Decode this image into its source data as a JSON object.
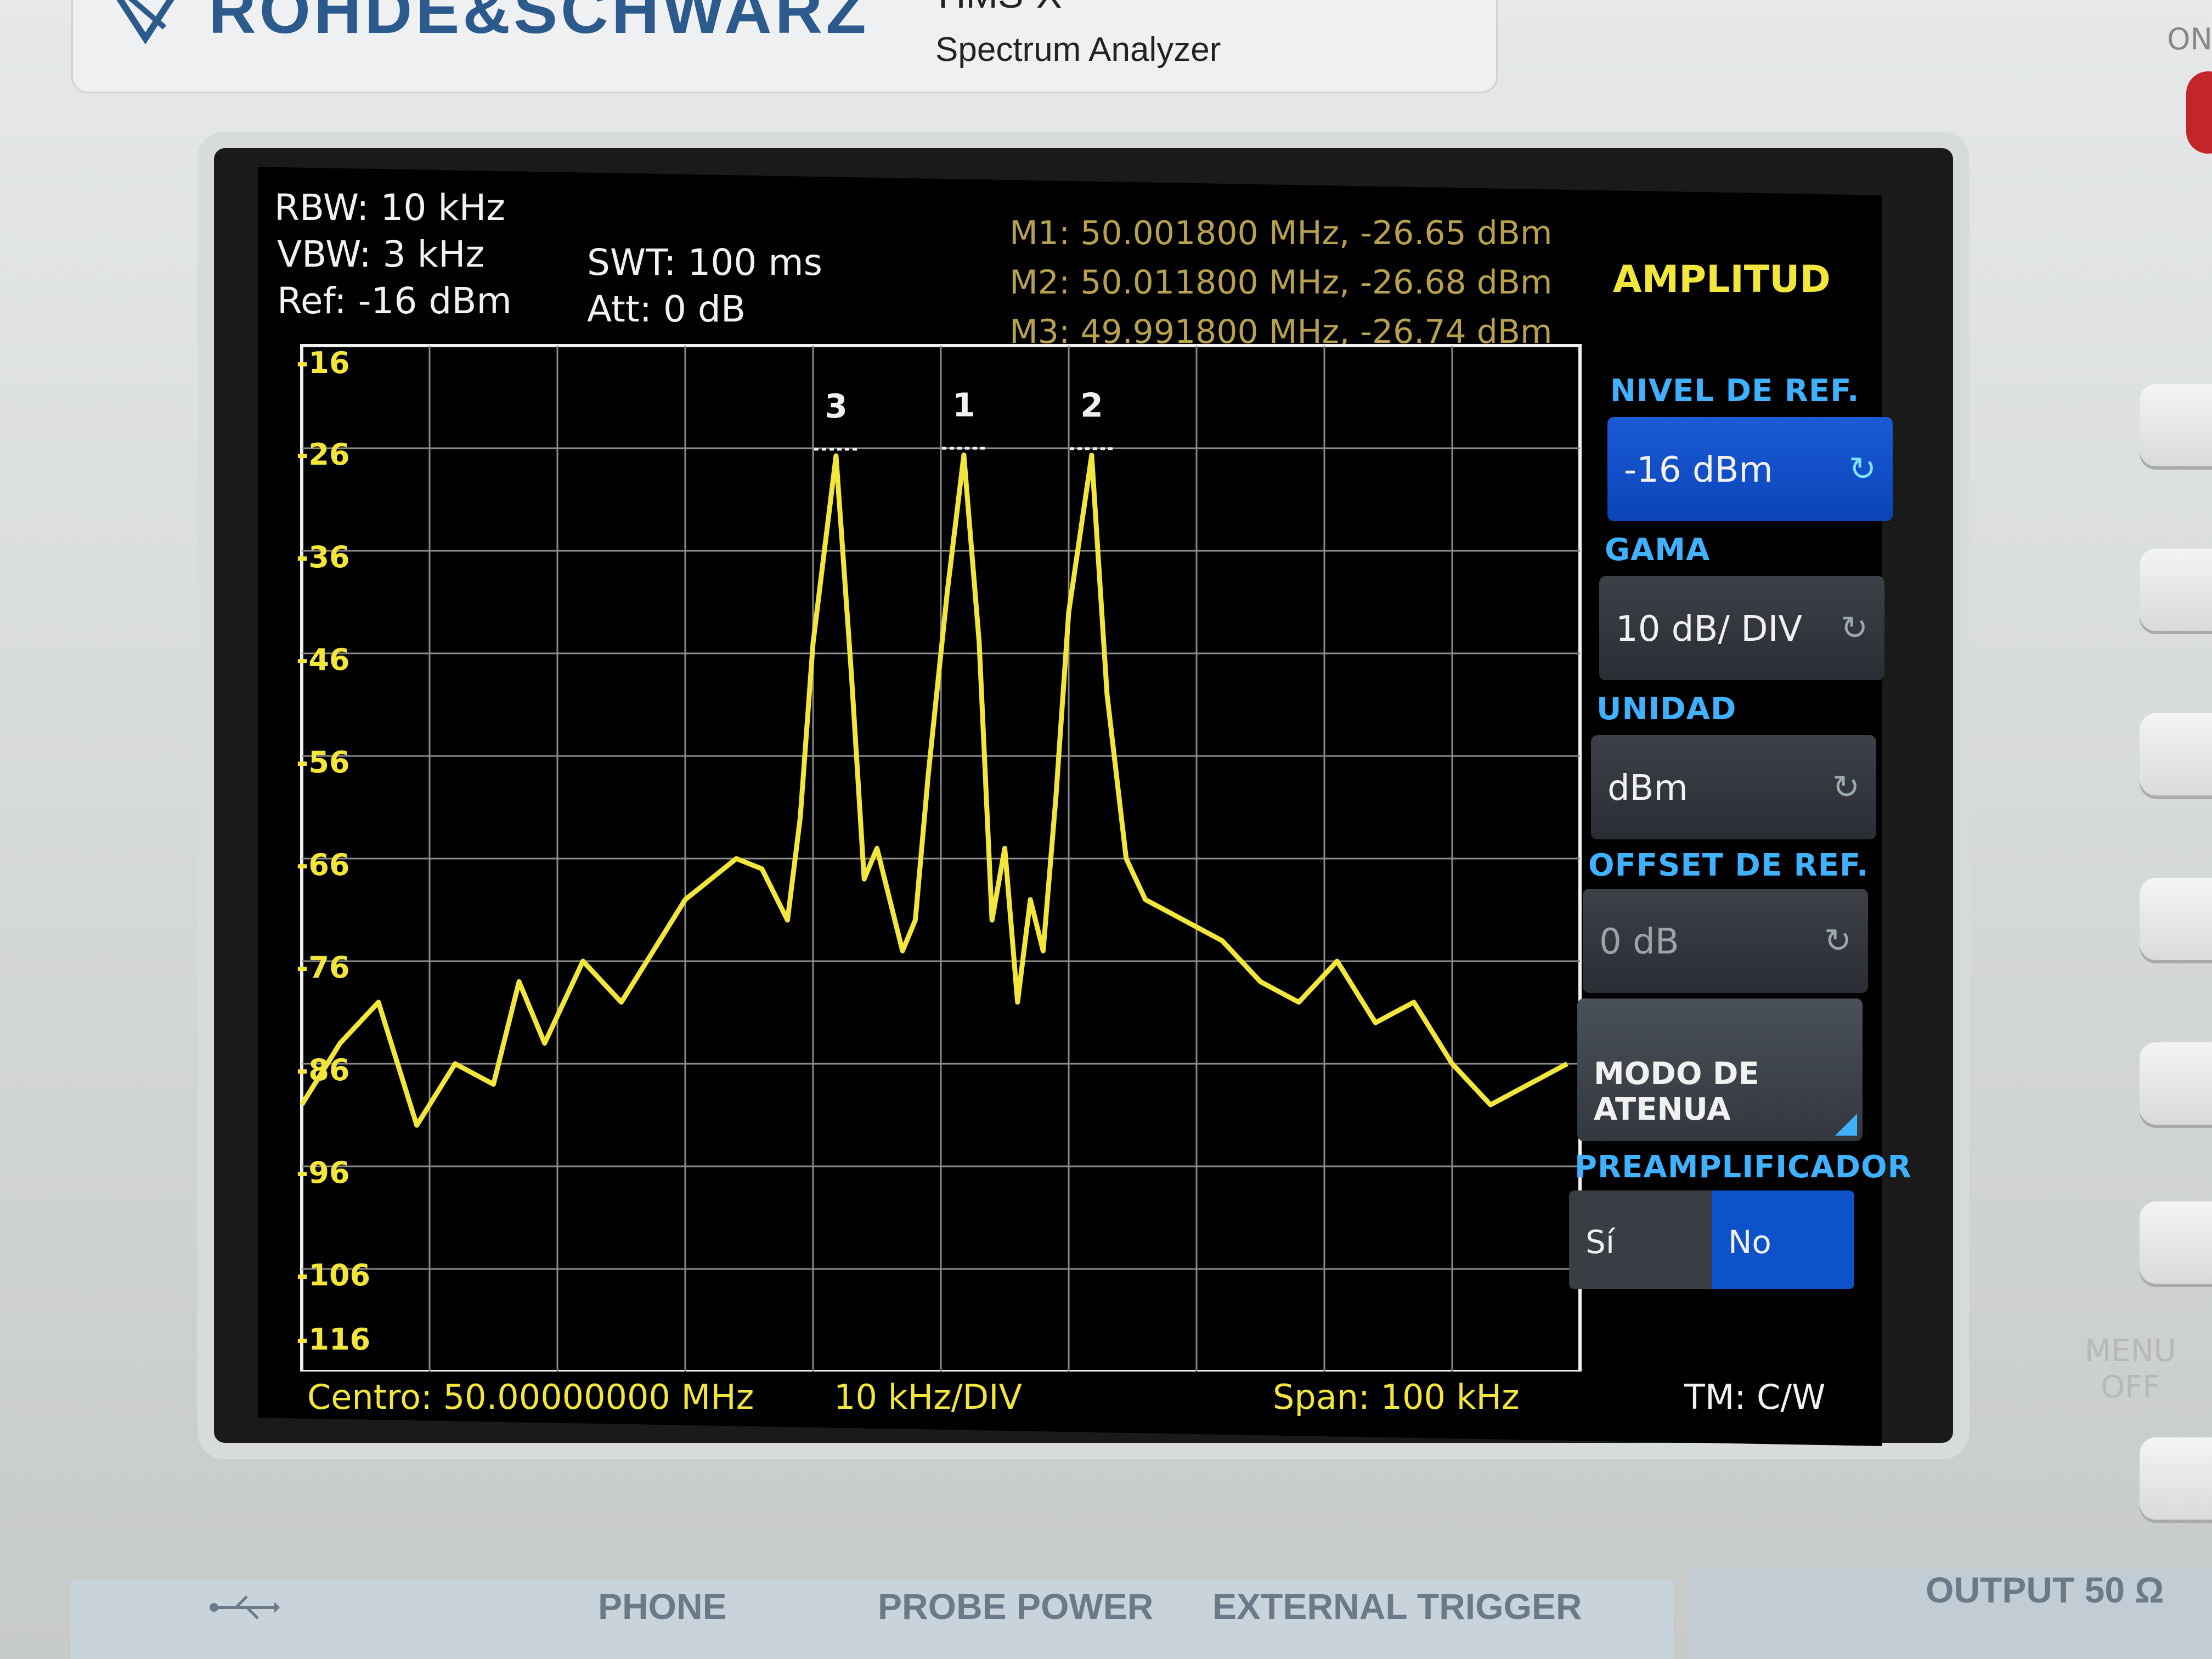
{
  "device": {
    "brand": "ROHDE&SCHWARZ",
    "model": "HMS-X",
    "subtitle": "Spectrum Analyzer",
    "power_label": "ON"
  },
  "header": {
    "rbw": "RBW: 10 kHz",
    "vbw": "VBW: 3 kHz",
    "ref": "Ref: -16 dBm",
    "swt": "SWT: 100 ms",
    "att": "Att: 0 dB"
  },
  "markers": [
    {
      "id": "M1",
      "text": "M1: 50.001800 MHz, -26.65 dBm",
      "label": "1",
      "freq_mhz": 50.0018,
      "level_dbm": -26.65
    },
    {
      "id": "M2",
      "text": "M2: 50.011800 MHz, -26.68 dBm",
      "label": "2",
      "freq_mhz": 50.0118,
      "level_dbm": -26.68
    },
    {
      "id": "M3",
      "text": "M3: 49.991800 MHz, -26.74 dBm",
      "label": "3",
      "freq_mhz": 49.9918,
      "level_dbm": -26.74
    }
  ],
  "y_tick_labels": [
    "-16",
    "-26",
    "-36",
    "-46",
    "-56",
    "-66",
    "-76",
    "-86",
    "-96",
    "-106",
    "-116"
  ],
  "footer": {
    "center": "Centro: 50.00000000 MHz",
    "div": "10 kHz/DIV",
    "span": "Span: 100 kHz",
    "tm": "TM: C/W"
  },
  "menu": {
    "title": "AMPLITUD",
    "ref_level_label": "NIVEL DE REF.",
    "ref_level_value": "-16 dBm",
    "range_label": "GAMA",
    "range_value": "10 dB/ DIV",
    "unit_label": "UNIDAD",
    "unit_value": "dBm",
    "ref_offset_label": "OFFSET DE REF.",
    "ref_offset_value": "0 dB",
    "atten_mode_label": "MODO DE ATENUA",
    "preamp_label": "PREAMPLIFICADOR",
    "preamp_yes": "Sí",
    "preamp_no": "No",
    "menu_off": "MENU\nOFF"
  },
  "ports": {
    "phone": "PHONE",
    "probe_power": "PROBE POWER",
    "external_trigger": "EXTERNAL TRIGGER",
    "output": "OUTPUT 50 Ω"
  },
  "colors": {
    "trace": "#f2e63a",
    "grid": "#8a8a8a",
    "active_softkey": "#0b44b8",
    "accent_blue": "#3fb1ff"
  },
  "chart_data": {
    "type": "line",
    "xlabel": "",
    "ylabel": "",
    "x_unit": "MHz",
    "y_unit": "dBm",
    "xlim": [
      49.95,
      50.05
    ],
    "ylim": [
      -116,
      -16
    ],
    "grid": true,
    "series": [
      {
        "x": [
          49.95,
          49.953,
          49.956,
          49.959,
          49.962,
          49.965,
          49.967,
          49.969,
          49.972,
          49.975,
          49.978,
          49.98,
          49.982,
          49.984,
          49.986,
          49.988,
          49.989,
          49.99,
          49.9918,
          49.993,
          49.994,
          49.995,
          49.997,
          49.998,
          49.999,
          50.0005,
          50.0018,
          50.003,
          50.004,
          50.005,
          50.006,
          50.007,
          50.008,
          50.009,
          50.01,
          50.0118,
          50.013,
          50.0145,
          50.016,
          50.019,
          50.022,
          50.025,
          50.028,
          50.031,
          50.034,
          50.037,
          50.04,
          50.043,
          50.046,
          50.049
        ],
        "y": [
          -90,
          -84,
          -80,
          -92,
          -86,
          -88,
          -78,
          -84,
          -76,
          -80,
          -74,
          -70,
          -68,
          -66,
          -67,
          -72,
          -62,
          -45,
          -26.74,
          -48,
          -68,
          -65,
          -75,
          -72,
          -58,
          -40,
          -26.65,
          -45,
          -72,
          -65,
          -80,
          -70,
          -75,
          -60,
          -42,
          -26.68,
          -50,
          -66,
          -70,
          -72,
          -74,
          -78,
          -80,
          -76,
          -82,
          -80,
          -86,
          -90,
          -88,
          -86
        ]
      }
    ]
  }
}
